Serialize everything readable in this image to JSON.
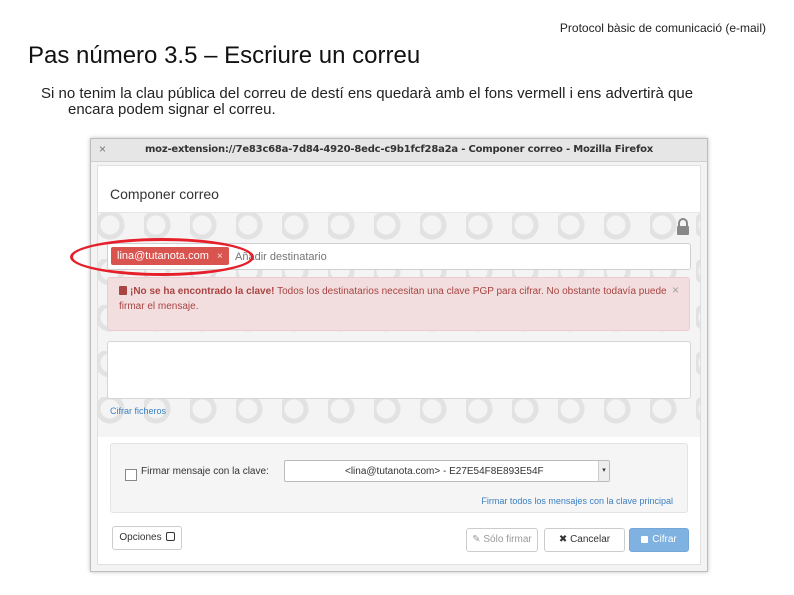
{
  "header_note": "Protocol bàsic de comunicació (e-mail)",
  "title": "Pas número 3.5 – Escriure un correu",
  "description": {
    "line1": "Si no tenim la clau pública del correu de destí ens quedarà amb el fons vermell i ens advertirà que",
    "line2": "encara podem signar el correu."
  },
  "window": {
    "title": "moz-extension://7e83c68a-7d84-4920-8edc-c9b1fcf28a2a - Componer correo - Mozilla Firefox",
    "close_glyph": "×"
  },
  "compose": {
    "heading": "Componer correo",
    "recipient_chip": "lina@tutanota.com",
    "chip_remove": "×",
    "add_recipient_placeholder": "Añadir destinatario",
    "alert_bold": "¡No se ha encontrado la clave!",
    "alert_text": " Todos los destinatarios necesitan una clave PGP para cifrar. No obstante todavía puede firmar el mensaje.",
    "alert_close": "×",
    "attach_link": "Cifrar ficheros",
    "sign_label": "Firmar mensaje con la clave:",
    "sign_key_value": "<lina@tutanota.com> - E27E54F8E893E54F",
    "select_arrow": "▾",
    "sign_all_link": "Firmar todos los mensajes con la clave principal",
    "options_button": "Opciones",
    "sign_only_button": "✎ Sólo firmar",
    "cancel_button": "✖ Cancelar",
    "encrypt_button": "Cifrar"
  },
  "colors": {
    "alert_background": "#f2dede",
    "recipient_chip": "#d9534f",
    "highlight_ellipse": "#e5202a",
    "encrypt_button": "#7fb2e1"
  },
  "icons": [
    "lock-icon",
    "close-icon",
    "pencil-icon",
    "options-icon"
  ]
}
